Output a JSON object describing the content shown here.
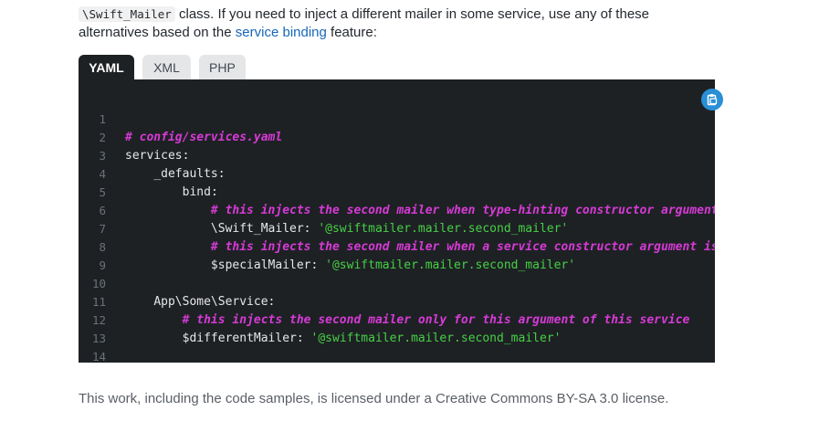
{
  "intro": {
    "line1_code": "\\Swift_Mailer",
    "line1_text": " class. If you need to inject a different mailer in some service, use any of these",
    "line2_text_before": "alternatives based on the ",
    "line2_link": "service binding",
    "line2_text_after": " feature:"
  },
  "tabs": [
    {
      "label": "YAML",
      "active": true
    },
    {
      "label": "XML",
      "active": false
    },
    {
      "label": "PHP",
      "active": false
    }
  ],
  "code": {
    "line_numbers": [
      "1",
      "2",
      "3",
      "4",
      "5",
      "6",
      "7",
      "8",
      "9",
      "10",
      "11",
      "12",
      "13",
      "14"
    ],
    "l1_comment": "# config/services.yaml",
    "l2_key": "services",
    "l2_colon": ":",
    "l3_key": "_defaults",
    "l3_colon": ":",
    "l4_key": "bind",
    "l4_colon": ":",
    "l5_comment": "# this injects the second mailer when type-hinting constructor arguments",
    "l6_key": "\\Swift_Mailer",
    "l6_colon": ": ",
    "l6_value": "'@swiftmailer.mailer.second_mailer'",
    "l7_comment": "# this injects the second mailer when a service constructor argument is",
    "l8_key": "$specialMailer",
    "l8_colon": ": ",
    "l8_value": "'@swiftmailer.mailer.second_mailer'",
    "l10_key": "App\\Some\\Service",
    "l10_colon": ":",
    "l11_comment": "# this injects the second mailer only for this argument of this service",
    "l12_key": "$differentMailer",
    "l12_colon": ": ",
    "l12_value": "'@swiftmailer.mailer.second_mailer'",
    "l14_comment": "# ..."
  },
  "colors": {
    "code_bg": "#1e2124",
    "comment": "#d63ad6",
    "string": "#46d046",
    "link": "#1867b8",
    "copy_button": "#2a8fd6"
  },
  "footer": {
    "text": "This work, including the code samples, is licensed under a Creative Commons BY-SA 3.0 license."
  }
}
